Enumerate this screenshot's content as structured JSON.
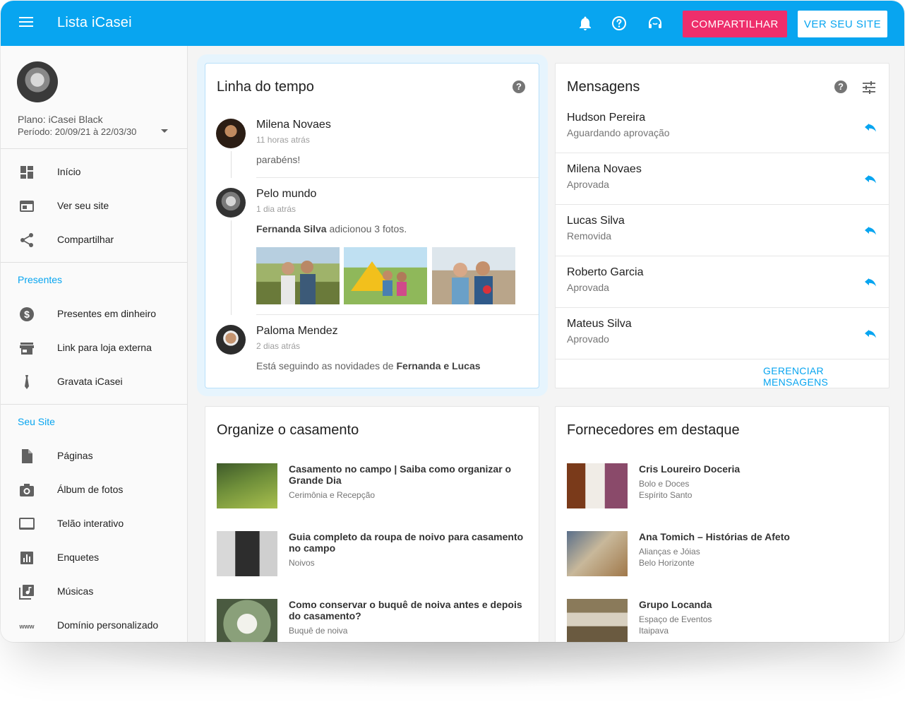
{
  "header": {
    "title": "Lista iCasei",
    "share_label": "COMPARTILHAR",
    "site_label": "VER SEU SITE"
  },
  "profile": {
    "plan": "Plano: iCasei Black",
    "period": "Período: 20/09/21 à 22/03/30"
  },
  "nav": {
    "main": [
      {
        "label": "Início",
        "icon": "dashboard-icon"
      },
      {
        "label": "Ver seu site",
        "icon": "browser-icon"
      },
      {
        "label": "Compartilhar",
        "icon": "share-icon"
      }
    ],
    "presentes_title": "Presentes",
    "presentes": [
      {
        "label": "Presentes em dinheiro",
        "icon": "money-icon"
      },
      {
        "label": "Link para loja externa",
        "icon": "store-icon"
      },
      {
        "label": "Gravata iCasei",
        "icon": "tie-icon"
      }
    ],
    "site_title": "Seu Site",
    "site": [
      {
        "label": "Páginas",
        "icon": "page-icon"
      },
      {
        "label": "Álbum de fotos",
        "icon": "camera-icon"
      },
      {
        "label": "Telão interativo",
        "icon": "screen-icon"
      },
      {
        "label": "Enquetes",
        "icon": "poll-icon"
      },
      {
        "label": "Músicas",
        "icon": "music-icon"
      },
      {
        "label": "Domínio personalizado",
        "icon": "www-icon"
      }
    ]
  },
  "timeline": {
    "title": "Linha do tempo",
    "items": [
      {
        "name": "Milena Novaes",
        "time": "11 horas atrás",
        "text": "parabéns!"
      },
      {
        "name": "Pelo mundo",
        "time": "1 dia atrás",
        "text_bold": "Fernanda Silva",
        "text": " adicionou 3 fotos."
      },
      {
        "name": "Paloma Mendez",
        "time": "2 dias atrás",
        "text": "Está seguindo as novidades de ",
        "text_bold": "Fernanda e Lucas"
      }
    ]
  },
  "messages": {
    "title": "Mensagens",
    "items": [
      {
        "name": "Hudson Pereira",
        "status": "Aguardando aprovação"
      },
      {
        "name": "Milena Novaes",
        "status": "Aprovada"
      },
      {
        "name": "Lucas Silva",
        "status": "Removida"
      },
      {
        "name": "Roberto Garcia",
        "status": "Aprovada"
      },
      {
        "name": "Mateus Silva",
        "status": "Aprovado"
      }
    ],
    "manage_label": "GERENCIAR MENSAGENS"
  },
  "organize": {
    "title": "Organize o casamento",
    "articles": [
      {
        "title": "Casamento no campo | Saiba como organizar o Grande Dia",
        "category": "Cerimônia e Recepção"
      },
      {
        "title": "Guia completo da roupa de noivo para casamento no campo",
        "category": "Noivos"
      },
      {
        "title": "Como conservar o buquê de noiva antes e depois do casamento?",
        "category": "Buquê de noiva"
      }
    ]
  },
  "suppliers": {
    "title": "Fornecedores em destaque",
    "items": [
      {
        "name": "Cris Loureiro Doceria",
        "category": "Bolo e Doces",
        "location": "Espírito Santo"
      },
      {
        "name": "Ana Tomich – Histórias de Afeto",
        "category": "Alianças e Jóias",
        "location": "Belo Horizonte"
      },
      {
        "name": "Grupo Locanda",
        "category": "Espaço de Eventos",
        "location": "Itaipava"
      }
    ]
  },
  "colors": {
    "brand": "#08a5f0",
    "accent": "#ee2e6b"
  }
}
